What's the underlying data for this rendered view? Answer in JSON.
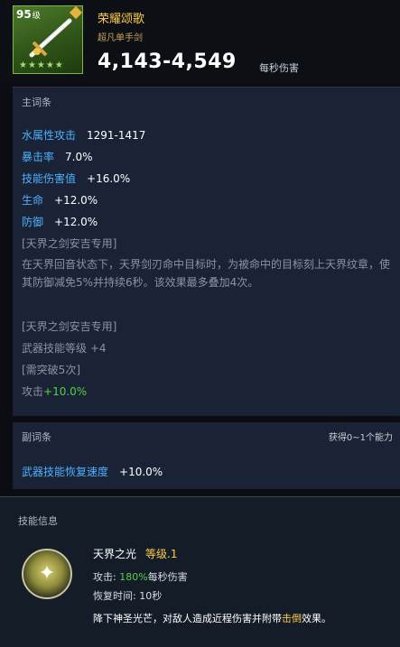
{
  "item": {
    "level": "95",
    "level_unit": "级",
    "stars": "★★★★★",
    "name": "荣耀颂歌",
    "type": "超凡单手剑",
    "damage": "4,143-4,549",
    "damage_unit": "每秒伤害"
  },
  "main": {
    "title": "主词条",
    "stats": [
      {
        "key": "水属性攻击",
        "value": "1291-1417"
      },
      {
        "key": "暴击率",
        "value": "7.0%"
      },
      {
        "key": "技能伤害值",
        "value": "+16.0%"
      },
      {
        "key": "生命",
        "value": "+12.0%"
      },
      {
        "key": "防御",
        "value": "+12.0%"
      }
    ],
    "exclusive_1": "[天界之剑安吉专用]",
    "desc": "在天界回音状态下，天界剑刃命中目标时，为被命中的目标刻上天界纹章，使其防御减免5%并持续6秒。该效果最多叠加4次。",
    "exclusive_2": "[天界之剑安吉专用]",
    "weapon_skill": "武器技能等级 +4",
    "breakthrough": "[需突破5次]",
    "attack_label": "攻击",
    "attack_value": "+10.0%"
  },
  "sub": {
    "title": "副词条",
    "note": "获得0~1个能力",
    "stat_key": "武器技能恢复速度",
    "stat_value": "+10.0%"
  },
  "skill": {
    "header": "技能信息",
    "name": "天界之光",
    "level": "等级.1",
    "attack_label": "攻击:",
    "attack_pct": "180%",
    "attack_suffix": "每秒伤害",
    "cooldown": "恢复时间:  10秒",
    "desc_pre": "降下神圣光芒，对敌人造成近程伤害并附带",
    "desc_hl": "击倒",
    "desc_post": "效果。"
  },
  "colors": {
    "accent_gold": "#ffcb4d",
    "stat_blue": "#4fb0ff",
    "green": "#54d04c"
  }
}
